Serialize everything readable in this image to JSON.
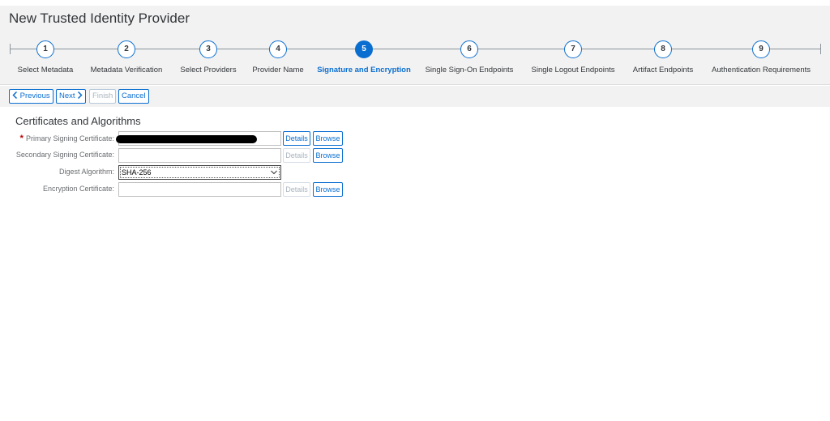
{
  "title": "New Trusted Identity Provider",
  "wizard": {
    "active_step": 5,
    "steps": [
      {
        "number": "1",
        "label": "Select Metadata"
      },
      {
        "number": "2",
        "label": "Metadata Verification"
      },
      {
        "number": "3",
        "label": "Select Providers"
      },
      {
        "number": "4",
        "label": "Provider Name"
      },
      {
        "number": "5",
        "label": "Signature and Encryption"
      },
      {
        "number": "6",
        "label": "Single Sign-On Endpoints"
      },
      {
        "number": "7",
        "label": "Single Logout Endpoints"
      },
      {
        "number": "8",
        "label": "Artifact Endpoints"
      },
      {
        "number": "9",
        "label": "Authentication Requirements"
      }
    ]
  },
  "toolbar": {
    "previous": "Previous",
    "next": "Next",
    "finish": "Finish",
    "cancel": "Cancel"
  },
  "section": {
    "title": "Certificates and Algorithms"
  },
  "form": {
    "primary_signing": {
      "label": "Primary Signing Certificate:",
      "required": "*",
      "value": ""
    },
    "secondary_signing": {
      "label": "Secondary Signing Certificate:",
      "value": ""
    },
    "digest_algorithm": {
      "label": "Digest Algorithm:",
      "value": "SHA-256"
    },
    "encryption": {
      "label": "Encryption Certificate:",
      "value": ""
    },
    "details_label": "Details",
    "browse_label": "Browse"
  },
  "colors": {
    "accent": "#0a6ed1",
    "required": "#bb0000",
    "header_bg": "#f2f2f2"
  },
  "icons": {
    "previous": "chevron-left-icon",
    "next": "chevron-right-icon",
    "select": "chevron-down-icon"
  }
}
